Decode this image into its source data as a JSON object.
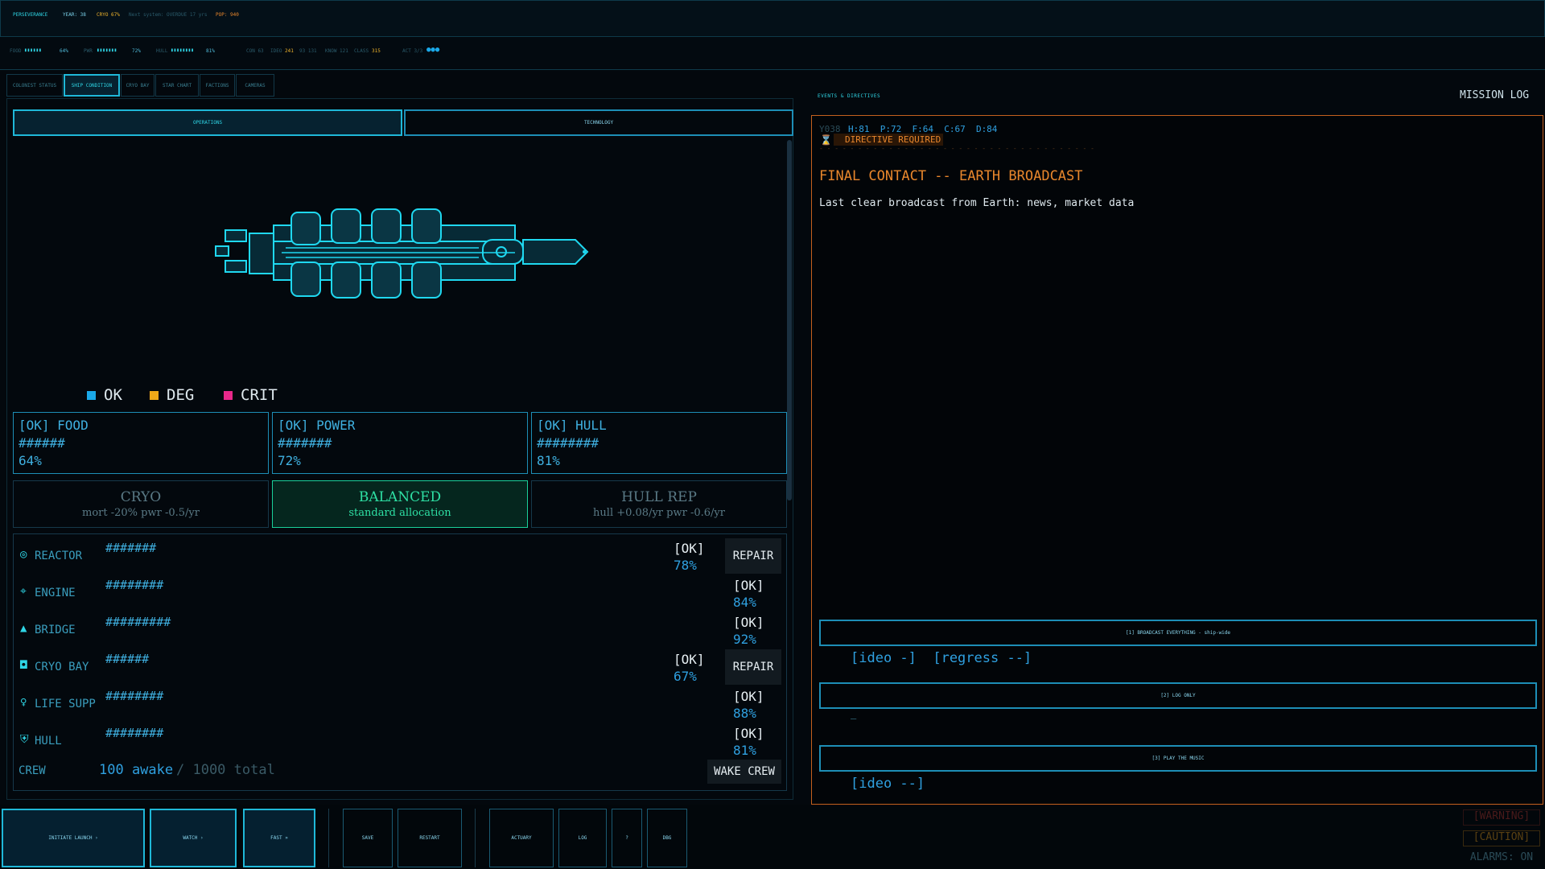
{
  "header": {
    "ship": "PERSEVERANCE",
    "year": "YEAR: 38",
    "cryo": "CRYO 67%",
    "status_line": "Next system: OVERDUE 17 yrs",
    "pop": "POP: 940",
    "food": "FOOD",
    "food_bar": "▮▮▮▮▮▮",
    "food_val": "64%",
    "power": "PWR",
    "power_bar": "▮▮▮▮▮▮▮",
    "power_val": "72%",
    "hull": "HULL",
    "hull_bar": "▮▮▮▮▮▮▮▮",
    "hull_val": "81%",
    "con": "CON 63",
    "ideo_label": "IDEO",
    "ideo_val": "241",
    "stats_a": "93 131",
    "know": "KNOW 121",
    "class_label": "CLASS",
    "class_val": "315",
    "acts": "ACT 3/3"
  },
  "tabs": [
    "COLONIST STATUS",
    "SHIP CONDITION",
    "CRYO BAY",
    "STAR CHART",
    "FACTIONS",
    "CAMERAS"
  ],
  "subtabs": [
    "OPERATIONS",
    "TECHNOLOGY"
  ],
  "legend": {
    "ok": "OK",
    "deg": "DEG",
    "crit": "CRIT",
    "ok_color": "#1aa8e8",
    "deg_color": "#f0a818",
    "crit_color": "#e8288a"
  },
  "status_boxes": [
    {
      "title": "[OK] FOOD",
      "bar": "######",
      "value": "64%"
    },
    {
      "title": "[OK] POWER",
      "bar": "#######",
      "value": "72%"
    },
    {
      "title": "[OK] HULL",
      "bar": "########",
      "value": "81%"
    }
  ],
  "modes": [
    {
      "title": "CRYO",
      "sub": "mort -20%  pwr -0.5/yr"
    },
    {
      "title": "BALANCED",
      "sub": "standard allocation"
    },
    {
      "title": "HULL REP",
      "sub": "hull +0.08/yr  pwr -0.6/yr"
    }
  ],
  "systems": [
    {
      "icon": "reactor-icon",
      "glyph": "◎",
      "name": "REACTOR",
      "bar": "#######",
      "status": "[OK]",
      "pct": "78%",
      "action": "REPAIR"
    },
    {
      "icon": "engine-icon",
      "glyph": "⌖",
      "name": "ENGINE",
      "bar": "########",
      "status": "[OK]",
      "pct": "84%",
      "action": ""
    },
    {
      "icon": "bridge-icon",
      "glyph": "▲",
      "name": "BRIDGE",
      "bar": "#########",
      "status": "[OK]",
      "pct": "92%",
      "action": ""
    },
    {
      "icon": "cryo-bay-icon",
      "glyph": "◘",
      "name": "CRYO BAY",
      "bar": "######",
      "status": "[OK]",
      "pct": "67%",
      "action": "REPAIR"
    },
    {
      "icon": "life-support-icon",
      "glyph": "♀",
      "name": "LIFE SUPP",
      "bar": "########",
      "status": "[OK]",
      "pct": "88%",
      "action": ""
    },
    {
      "icon": "hull-icon",
      "glyph": "⛨",
      "name": "HULL",
      "bar": "########",
      "status": "[OK]",
      "pct": "81%",
      "action": ""
    }
  ],
  "crew": {
    "label": "CREW",
    "awake": "100 awake",
    "total": "/ 1000 total",
    "action": "WAKE CREW"
  },
  "right": {
    "section_label": "EVENTS & DIRECTIVES",
    "log_button": "MISSION LOG",
    "stats_year": "Y038",
    "stats": "H:81  P:72  F:64  C:67  D:84",
    "directive": "DIRECTIVE REQUIRED",
    "divider": "- - - - - - - - - - - - - - - - - - - - - - - - - - - - - - - - - - - -",
    "event_title": "FINAL CONTACT -- EARTH BROADCAST",
    "event_body": "Last clear broadcast from Earth: news, market data",
    "choices": [
      {
        "label": "[1]  BROADCAST EVERYTHING - ship-wide",
        "tags": "[ideo -]  [regress --]"
      },
      {
        "label": "[2]  LOG ONLY",
        "tags": "—"
      },
      {
        "label": "[3]  PLAY THE MUSIC",
        "tags": "[ideo --]"
      }
    ]
  },
  "bottom": {
    "buttons": [
      "INITIATE LAUNCH ›",
      "WATCH ›",
      "FAST »",
      "SAVE",
      "RESTART",
      "ACTUARY",
      "LOG",
      "?",
      "DBG"
    ],
    "alarms": [
      "[WARNING]",
      "[CAUTION]",
      "ALARMS: ON"
    ]
  }
}
